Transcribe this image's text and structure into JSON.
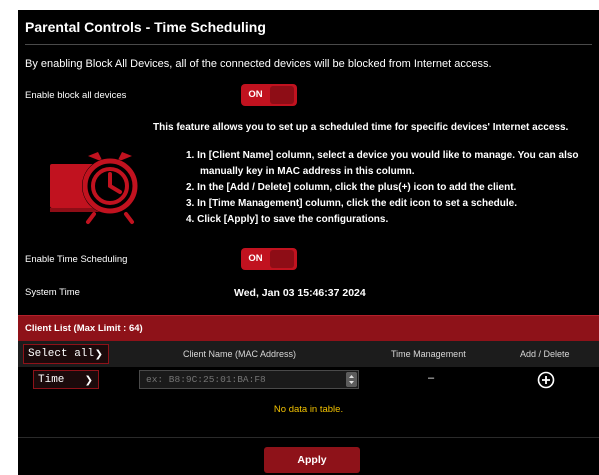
{
  "header": {
    "title": "Parental Controls - Time Scheduling"
  },
  "block_all": {
    "description": "By enabling Block All Devices, all of the connected devices will be blocked from Internet access.",
    "label": "Enable block all devices",
    "toggle_label": "ON"
  },
  "feature": {
    "intro": "This feature allows you to set up a scheduled time for specific devices' Internet access.",
    "steps": [
      "1. In [Client Name] column, select a device you would like to manage. You can also",
      "manually key in MAC address in this column.",
      "2. In the [Add / Delete] column, click the plus(+) icon to add the client.",
      "3. In [Time Management] column, click the edit icon to set a schedule.",
      "4. Click [Apply] to save the configurations."
    ]
  },
  "time_scheduling": {
    "label": "Enable Time Scheduling",
    "toggle_label": "ON"
  },
  "system_time": {
    "label": "System Time",
    "value": "Wed, Jan 03 15:46:37 2024"
  },
  "client_list": {
    "title": "Client List (Max Limit : 64)",
    "columns": {
      "select": "Select all",
      "client_name": "Client Name (MAC Address)",
      "time_management": "Time Management",
      "add_delete": "Add / Delete"
    },
    "new_row": {
      "mode": "Time",
      "mac_placeholder": "ex: B8:9C:25:01:BA:F8",
      "time_management": "–"
    },
    "empty_message": "No data in table."
  },
  "buttons": {
    "apply": "Apply"
  },
  "colors": {
    "accent": "#c1121f",
    "header_bar": "#8e1219",
    "notice": "#f2c200"
  }
}
